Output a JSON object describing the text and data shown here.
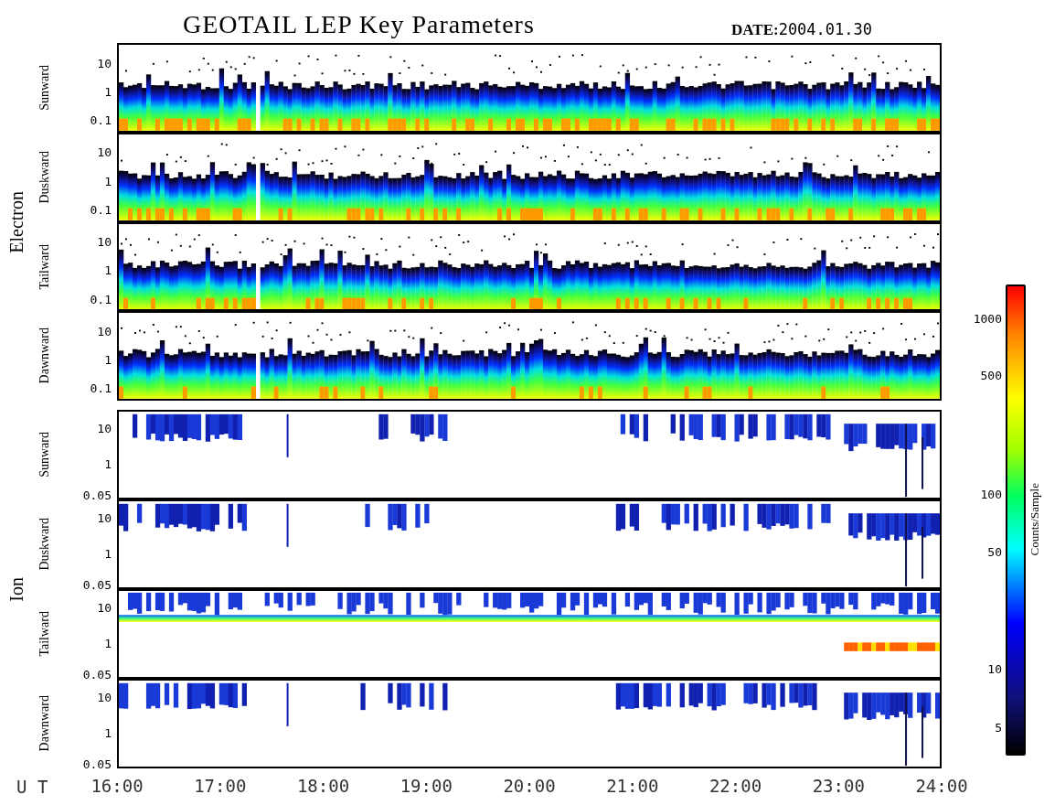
{
  "title": "GEOTAIL LEP Key Parameters",
  "date_label": "DATE:",
  "date": "2004.01.30",
  "groups": [
    {
      "name": "Electron",
      "panels": [
        {
          "direction": "Sunward",
          "kind": "electron",
          "y_ticks": [
            "10",
            "1",
            "0.1"
          ]
        },
        {
          "direction": "Duskward",
          "kind": "electron",
          "y_ticks": [
            "10",
            "1",
            "0.1"
          ]
        },
        {
          "direction": "Tailward",
          "kind": "electron",
          "y_ticks": [
            "10",
            "1",
            "0.1"
          ]
        },
        {
          "direction": "Dawnward",
          "kind": "electron",
          "y_ticks": [
            "10",
            "1",
            "0.1"
          ]
        }
      ]
    },
    {
      "name": "Ion",
      "panels": [
        {
          "direction": "Sunward",
          "kind": "ion",
          "y_ticks": [
            "10",
            "1",
            "0.05"
          ]
        },
        {
          "direction": "Duskward",
          "kind": "ion",
          "y_ticks": [
            "10",
            "1",
            "0.05"
          ]
        },
        {
          "direction": "Tailward",
          "kind": "beam",
          "y_ticks": [
            "10",
            "1",
            "0.05"
          ]
        },
        {
          "direction": "Dawnward",
          "kind": "ion",
          "y_ticks": [
            "10",
            "1",
            "0.05"
          ]
        }
      ]
    }
  ],
  "x_axis": {
    "label": "U T",
    "ticks": [
      "16:00",
      "17:00",
      "18:00",
      "19:00",
      "20:00",
      "21:00",
      "22:00",
      "23:00",
      "24:00"
    ]
  },
  "colorbar": {
    "label": "Counts/Sample",
    "ticks": [
      "1000",
      "500",
      "100",
      "50",
      "10",
      "5"
    ]
  }
}
